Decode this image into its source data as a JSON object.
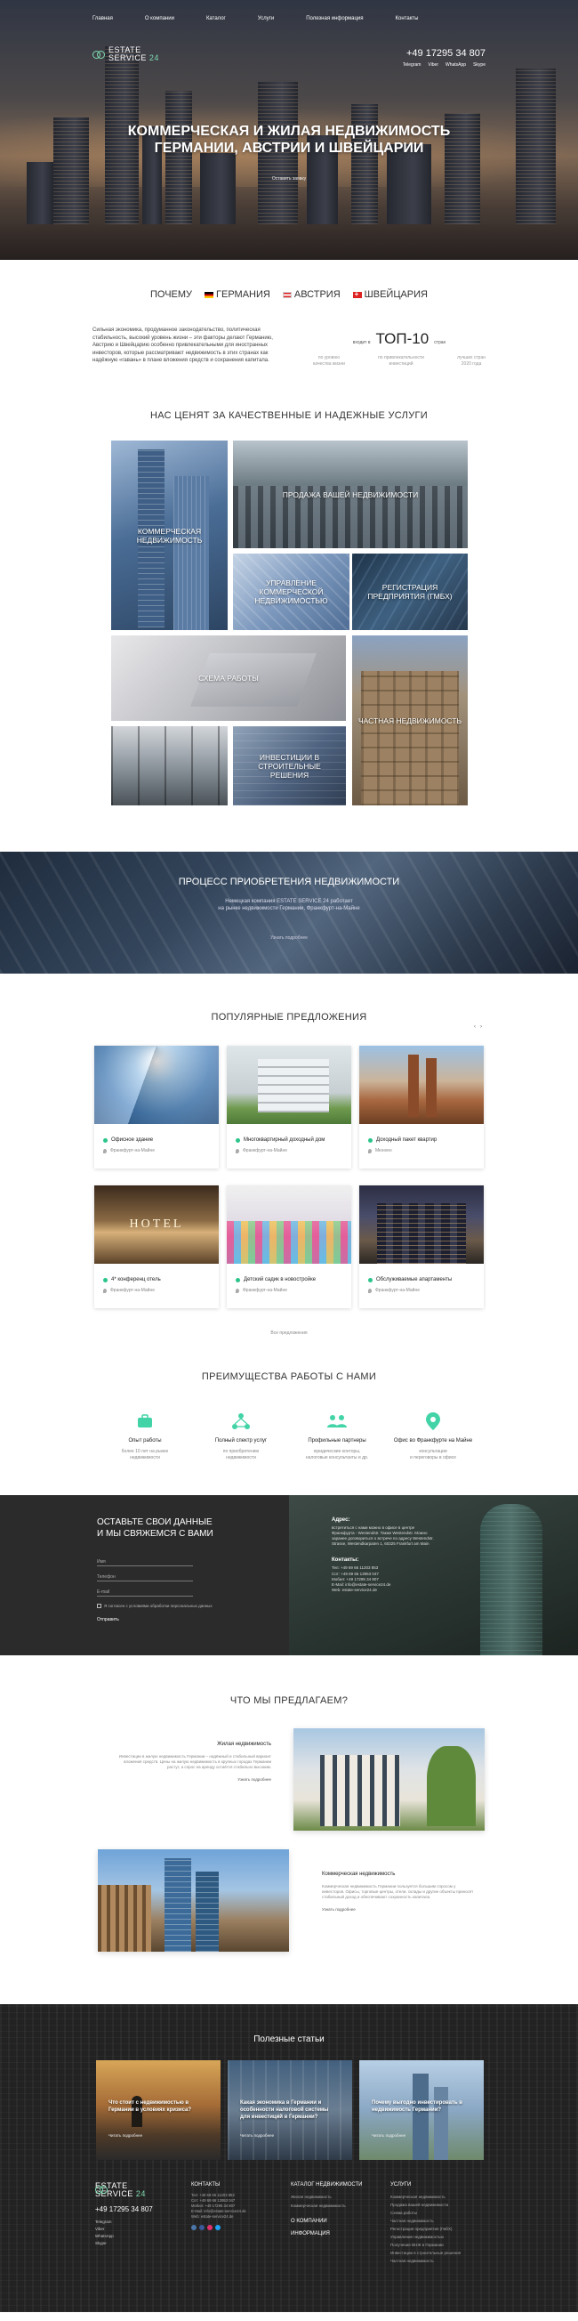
{
  "hero": {
    "nav": [
      "Главная",
      "О компании",
      "Каталог",
      "Услуги",
      "Полезная информация",
      "Контакты"
    ],
    "logo_line1": "ESTATE",
    "logo_line2": "SERVICE",
    "logo_num": "24",
    "phone": "+49 17295 34 807",
    "contacts": [
      "Telegram",
      "Viber",
      "WhatsApp",
      "Skype"
    ],
    "title_line1": "КОММЕРЧЕСКАЯ И ЖИЛАЯ НЕДВИЖИМОСТЬ",
    "title_line2": "ГЕРМАНИИ, АВСТРИИ И ШВЕЙЦАРИИ",
    "cta": "Оставить заявку"
  },
  "why": {
    "tabs": [
      "ПОЧЕМУ",
      "ГЕРМАНИЯ",
      "АВСТРИЯ",
      "ШВЕЙЦАРИЯ"
    ],
    "text": "Сильная экономика, продуманное законодательство, политическая стабильность, высокий уровень жизни – эти факторы делают Германию, Австрию и Швейцарию особенно привлекательными для иностранных инвесторов, которые рассматривают недвижимость в этих странах как надёжную «гавань» в плане вложения средств и сохранения капитала.",
    "rank_pre": "входит в",
    "rank_big": "ТОП-10",
    "rank_post": "стран",
    "rank_cols": [
      "по уровню\nкачества жизни",
      "по привлекательности\nинвестиций",
      "лучших стран\n2020 года"
    ]
  },
  "services": {
    "title": "НАС ЦЕНЯТ ЗА КАЧЕСТВЕННЫЕ И НАДЕЖНЫЕ УСЛУГИ",
    "tiles": [
      "КОММЕРЧЕСКАЯ НЕДВИЖИМОСТЬ",
      "ПРОДАЖА ВАШЕЙ НЕДВИЖИМОСТИ",
      "УПРАВЛЕНИЕ КОММЕРЧЕСКОЙ НЕДВИЖИМОСТЬЮ",
      "РЕГИСТРАЦИЯ ПРЕДПРИЯТИЯ (ГМБХ)",
      "СХЕМА РАБОТЫ",
      "ЧАСТНАЯ НЕДВИЖИМОСТЬ",
      "ИНВЕСТИЦИИ В СТРОИТЕЛЬНЫЕ РЕШЕНИЯ"
    ]
  },
  "process": {
    "title": "ПРОЦЕСС ПРИОБРЕТЕНИЯ НЕДВИЖИМОСТИ",
    "text_line1": "Немецкая компания ESTATE SERVICE 24 работает",
    "text_line2": "на рынке недвижимости Германии, Франкфурт-на-Майне",
    "more": "Узнать подробнее"
  },
  "popular": {
    "title": "ПОПУЛЯРНЫЕ ПРЕДЛОЖЕНИЯ",
    "prev": "‹",
    "next": "›",
    "cards": [
      {
        "title": "Офисное здание",
        "location": "Франкфурт-на-Майне"
      },
      {
        "title": "Многоквартирный доходный дом",
        "location": "Франкфурт-на-Майне"
      },
      {
        "title": "Доходный пакет квартир",
        "location": "Мюнхен"
      },
      {
        "title": "4* конференц отель",
        "location": "Франкфурт-на-Майне"
      },
      {
        "title": "Детский садик в новостройке",
        "location": "Франкфурт-на-Майне"
      },
      {
        "title": "Обслуживаемые апартаменты",
        "location": "Франкфурт-на-Майне"
      }
    ],
    "all": "Все предложения"
  },
  "advantages": {
    "title": "ПРЕИМУЩЕСТВА РАБОТЫ С НАМИ",
    "items": [
      {
        "name": "Опыт работы",
        "desc": "более 10 лет на рынке\nнедвижимости"
      },
      {
        "name": "Полный спектр услуг",
        "desc": "по приобретению\nнедвижимости"
      },
      {
        "name": "Профильные партнеры",
        "desc": "юридические конторы,\nналоговые консультанты и др."
      },
      {
        "name": "Офис во Франкфурте на Майне",
        "desc": "консультации\nи переговоры в офисе"
      }
    ]
  },
  "contact": {
    "title_line1": "ОСТАВЬТЕ СВОИ ДАННЫЕ",
    "title_line2": "И МЫ СВЯЖЕМСЯ С ВАМИ",
    "fields": [
      "Имя",
      "Телефон",
      "E-mail"
    ],
    "agree": "Я согласен с условиями обработки персональных данных",
    "send": "Отправить",
    "address_title": "Адрес:",
    "address": "встретиться с нами можно в офисе в центре Франкфурта - Westendstr. Также Westendstr. Можно заранее договориться о встрече по адресу Westendstr. Strasse, Westendkarpaten 1, 60325 Frankfurt am Main",
    "contacts_title": "Контакты:",
    "contacts": [
      "Тел: +49 69 66 11203 853",
      "Сот: +49 69 66 13953 047",
      "Мобил: +49 17295 34 807",
      "E-Mail: info@estate-service24.de",
      "Web: estate-service24.de"
    ]
  },
  "offer": {
    "title": "ЧТО МЫ ПРЕДЛАГАЕМ?",
    "items": [
      {
        "title": "Жилая недвижимость",
        "text": "Инвестиции в жилую недвижимость Германии – надёжный и стабильный вариант вложения средств. Цены на жилую недвижимость в крупных городах Германии растут, а спрос на аренду остаётся стабильно высоким.",
        "more": "Узнать подробнее"
      },
      {
        "title": "Коммерческая недвижимость",
        "text": "Коммерческая недвижимость Германии пользуется большим спросом у инвесторов. Офисы, торговые центры, отели, склады и другие объекты приносят стабильный доход и обеспечивают сохранность капитала.",
        "more": "Узнать подробнее"
      }
    ]
  },
  "articles": {
    "title": "Полезные статьи",
    "items": [
      {
        "title": "Что стоит с недвижимостью в Германии в условиях кризиса?",
        "more": "Читать подробнее"
      },
      {
        "title": "Какая экономика в Германии и особенности налоговой системы для инвестиций в Германии?",
        "more": "Читать подробнее"
      },
      {
        "title": "Почему выгодно инвестировать в недвижимость Германии?",
        "more": "Читать подробнее"
      }
    ]
  },
  "footer": {
    "phone": "+49 17295 34 807",
    "messengers": [
      "Telegram",
      "Viber",
      "WhatsApp",
      "Skype"
    ],
    "cols": [
      {
        "title": "КОНТАКТЫ",
        "lines": [
          "Тел: +49 69 66 11203 853",
          "Сот: +49 69 66 13953 047",
          "Мобил: +49 17295 34 807",
          "E-Mail: info@estate-service24.de",
          "Web: estate-service24.de"
        ]
      },
      {
        "title": "КАТАЛОГ НЕДВИЖИМОСТИ",
        "lines": [
          "Жилая недвижимость",
          "Коммерческая недвижимость"
        ],
        "extra": [
          "О КОМПАНИИ",
          "ИНФОРМАЦИЯ"
        ]
      },
      {
        "title": "УСЛУГИ",
        "lines": [
          "Коммерческая недвижимость",
          "Продажа вашей недвижимости",
          "Схема работы",
          "Частная недвижимость",
          "Регистрация предприятия (ГмбХ)",
          "Управление недвижимостью",
          "Получение ВНЖ в Германии",
          "Инвестиции в строительные решения",
          "Частная недвижимость"
        ]
      }
    ]
  }
}
